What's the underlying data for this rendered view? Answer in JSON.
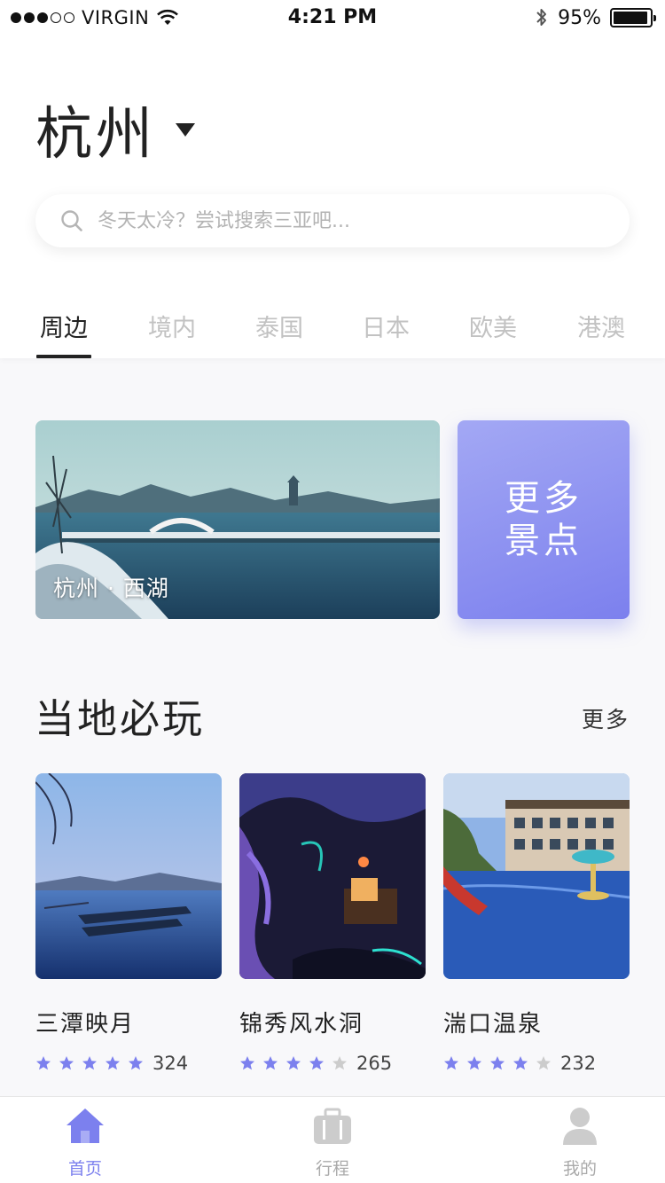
{
  "status_bar": {
    "carrier": "VIRGIN",
    "time": "4:21 PM",
    "battery": "95%",
    "battery_level": 0.95,
    "signal_bars": 3,
    "signal_total": 5
  },
  "city": {
    "name": "杭州"
  },
  "search": {
    "placeholder": "冬天太冷？尝试搜索三亚吧..."
  },
  "tabs": [
    {
      "label": "周边",
      "active": true
    },
    {
      "label": "境内",
      "active": false
    },
    {
      "label": "泰国",
      "active": false
    },
    {
      "label": "日本",
      "active": false
    },
    {
      "label": "欧美",
      "active": false
    },
    {
      "label": "港澳",
      "active": false
    }
  ],
  "banner": {
    "caption": "杭州 · 西湖"
  },
  "more_spots": {
    "label": "更多景点"
  },
  "section": {
    "title": "当地必玩",
    "more": "更多"
  },
  "cards": [
    {
      "name": "三潭映月",
      "rating": 5,
      "count": "324"
    },
    {
      "name": "锦秀风水洞",
      "rating": 4,
      "count": "265"
    },
    {
      "name": "湍口温泉",
      "rating": 4,
      "count": "232"
    }
  ],
  "tab_bar": [
    {
      "label": "首页",
      "icon": "home-icon",
      "active": true
    },
    {
      "label": "行程",
      "icon": "luggage-icon",
      "active": false
    },
    {
      "label": "我的",
      "icon": "user-icon",
      "active": false
    }
  ],
  "colors": {
    "accent": "#7c80ee",
    "star_active": "#7c80ee",
    "star_inactive": "#cccccc",
    "tab_inactive": "#c2c2c2"
  }
}
